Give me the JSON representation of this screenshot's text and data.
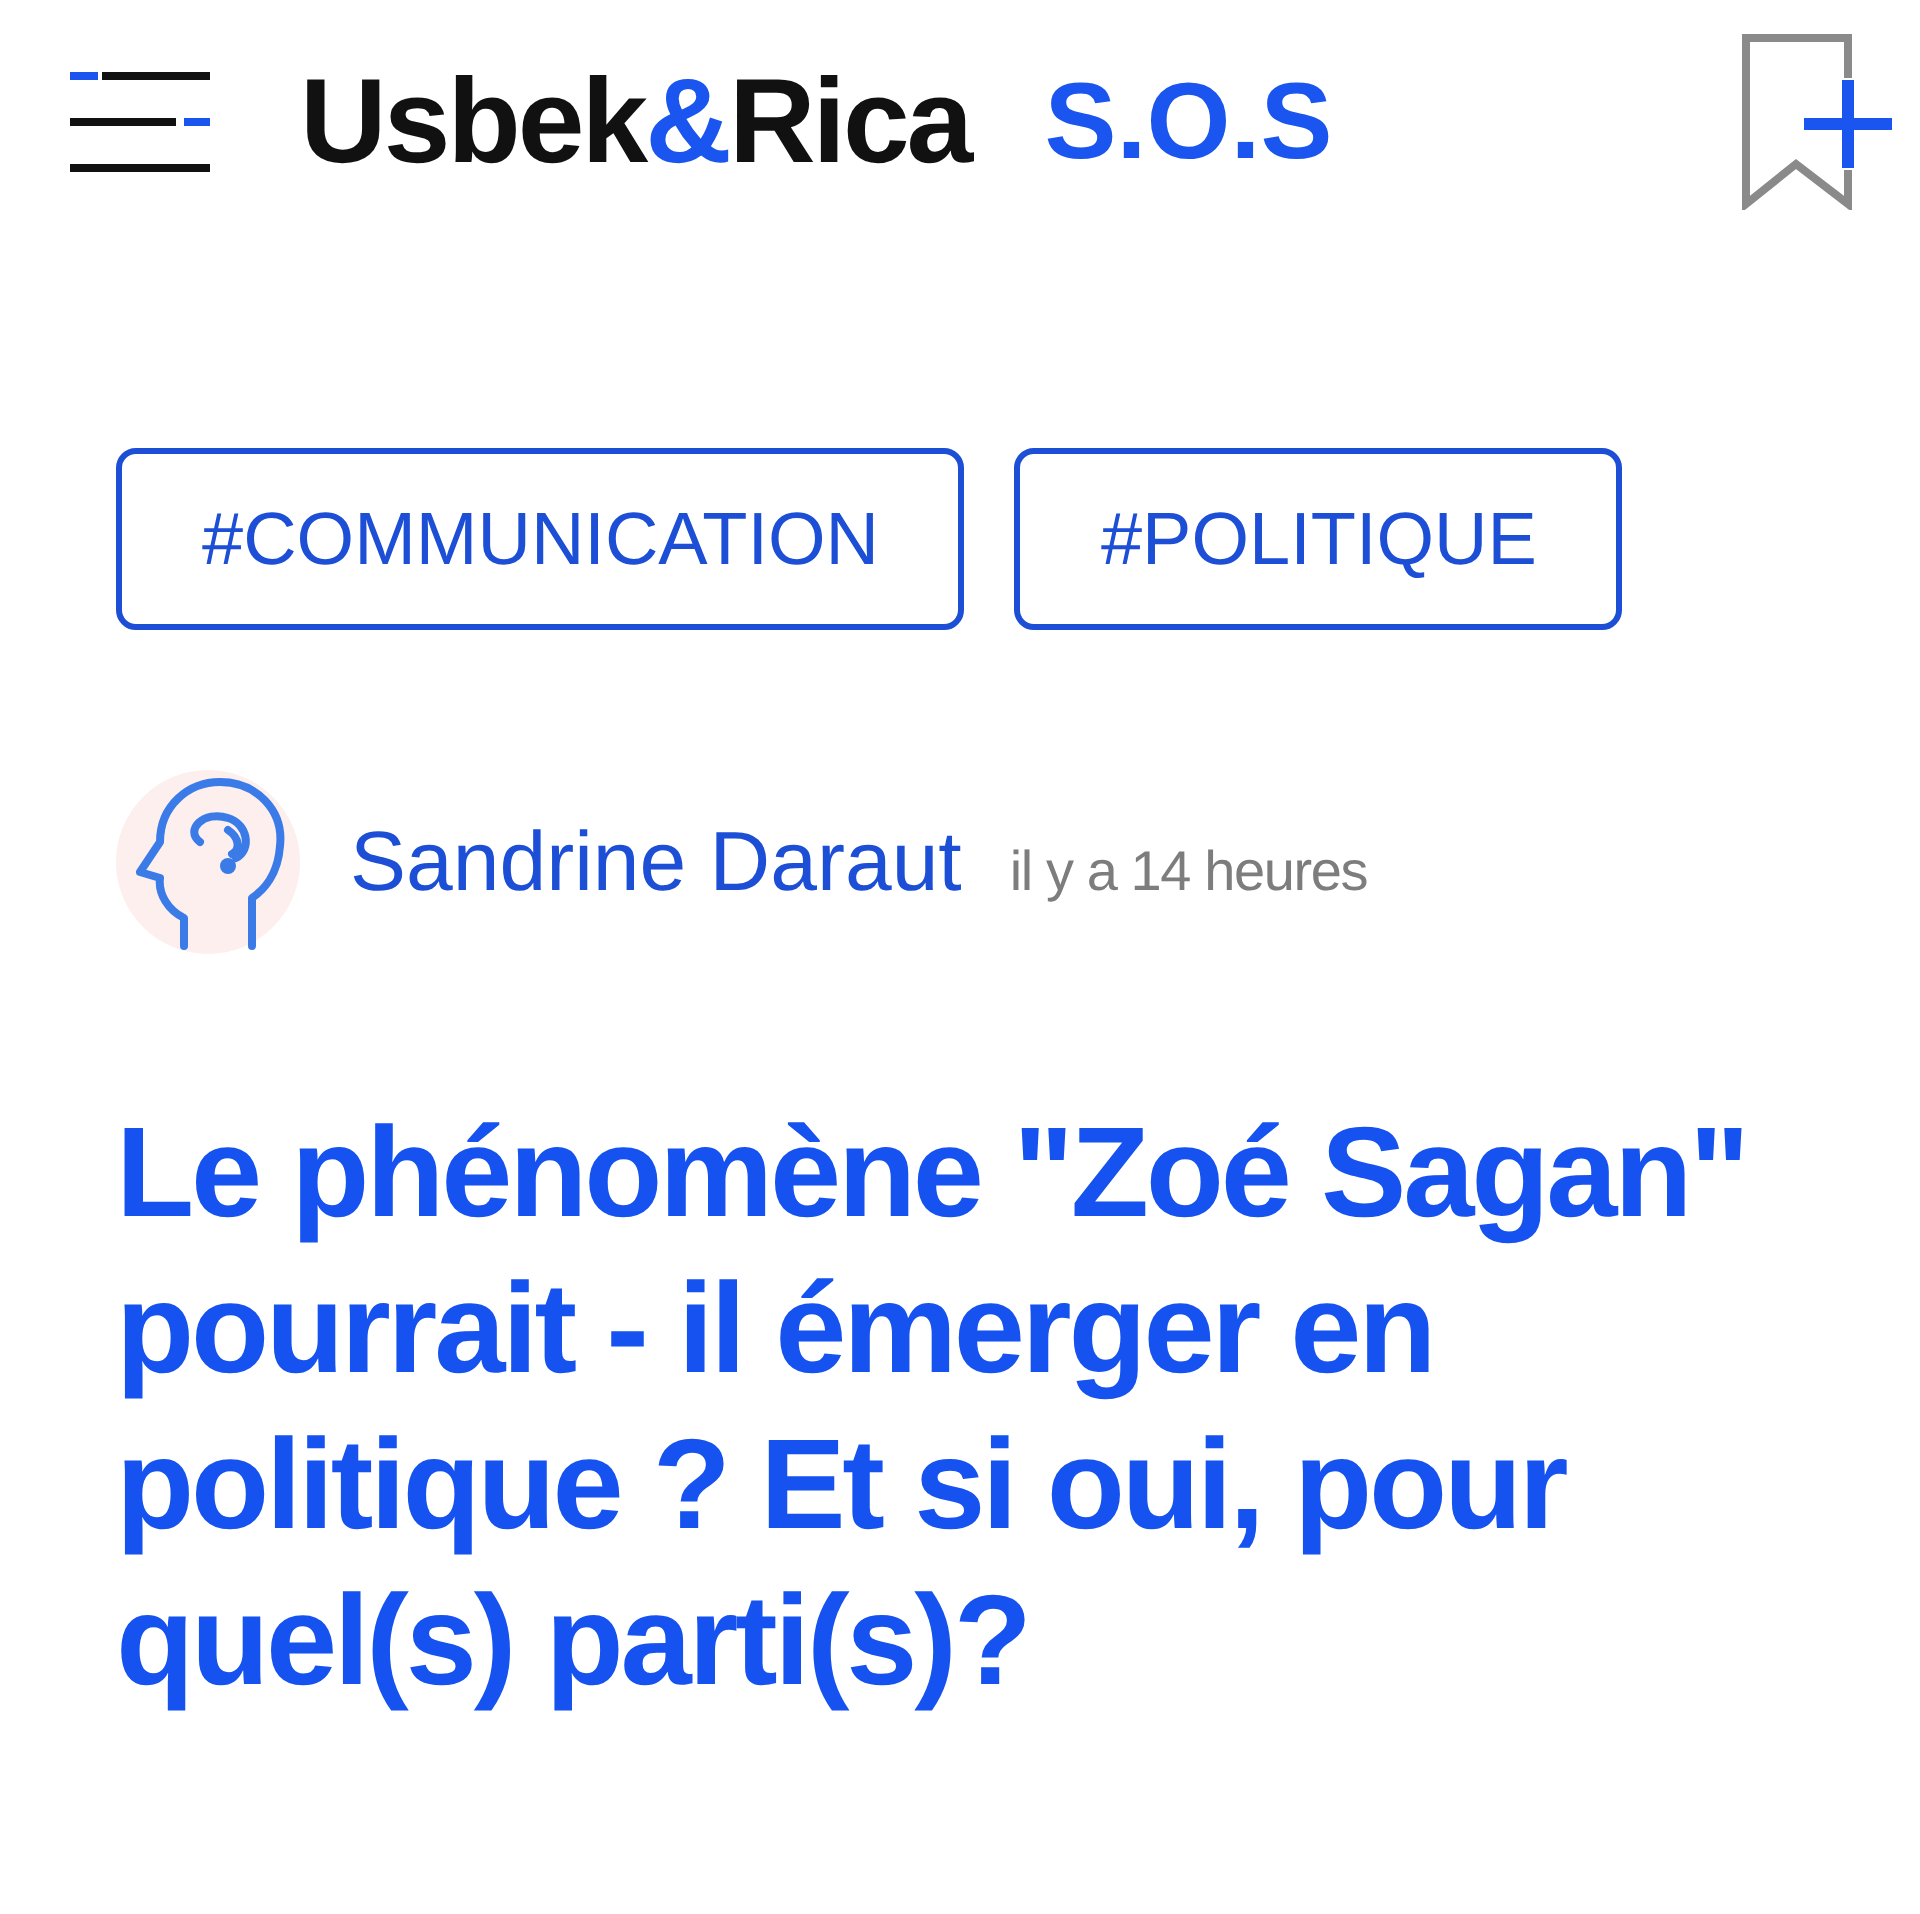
{
  "header": {
    "logo": {
      "parts": [
        {
          "text": "Usbek",
          "accent": false
        },
        {
          "text": "&",
          "accent": true
        },
        {
          "text": "Rica",
          "accent": false
        }
      ]
    },
    "section": "S.O.S"
  },
  "tags": [
    "#COMMUNICATION",
    "#POLITIQUE"
  ],
  "author": {
    "name": "Sandrine Daraut",
    "time": "il y a 14 heures"
  },
  "headline": "Le phénomène \"Zoé Sagan\" pourrait - il émerger en politique ? Et si oui, pour quel(s) parti(s)?"
}
